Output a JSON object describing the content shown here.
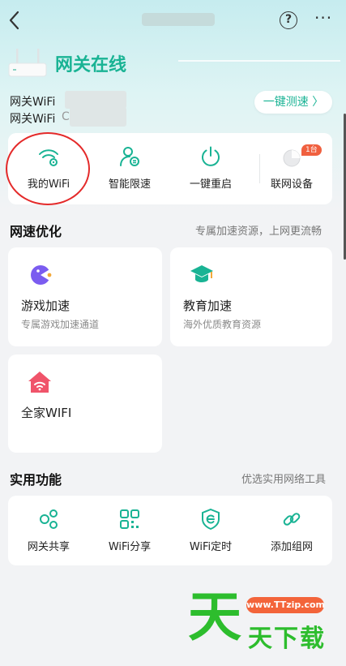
{
  "header": {
    "title_hidden": "",
    "help_glyph": "?",
    "more_glyph": "···"
  },
  "gateway": {
    "status": "网关在线",
    "wifi_label_1": "网关WiFi",
    "wifi_label_2": "网关WiFi",
    "wifi_value_2_partial": "C",
    "speed_test_label": "一键测速 〉"
  },
  "quick_actions": [
    {
      "label": "我的WiFi",
      "icon": "wifi-icon"
    },
    {
      "label": "智能限速",
      "icon": "user-speed-icon"
    },
    {
      "label": "一键重启",
      "icon": "power-icon"
    },
    {
      "label": "联网设备",
      "icon": "device-icon",
      "badge": "1台"
    }
  ],
  "speed_opt": {
    "title": "网速优化",
    "subtitle": "专属加速资源，上网更流畅",
    "cards": [
      {
        "title": "游戏加速",
        "desc": "专属游戏加速通道",
        "icon": "game-icon"
      },
      {
        "title": "教育加速",
        "desc": "海外优质教育资源",
        "icon": "education-icon"
      },
      {
        "title": "全家WIFI",
        "desc": "",
        "icon": "home-wifi-icon"
      }
    ]
  },
  "tools": {
    "title": "实用功能",
    "subtitle": "优选实用网络工具",
    "items": [
      {
        "label": "网关共享",
        "icon": "share-icon"
      },
      {
        "label": "WiFi分享",
        "icon": "qr-icon"
      },
      {
        "label": "WiFi定时",
        "icon": "timer-shield-icon"
      },
      {
        "label": "添加组网",
        "icon": "link-icon"
      }
    ]
  },
  "watermark": {
    "url": "www.TTzip.com",
    "big_char": "天",
    "text": "天下载"
  },
  "colors": {
    "accent": "#19b394",
    "badge": "#f0603f",
    "highlight_ring": "#e42a2a"
  }
}
